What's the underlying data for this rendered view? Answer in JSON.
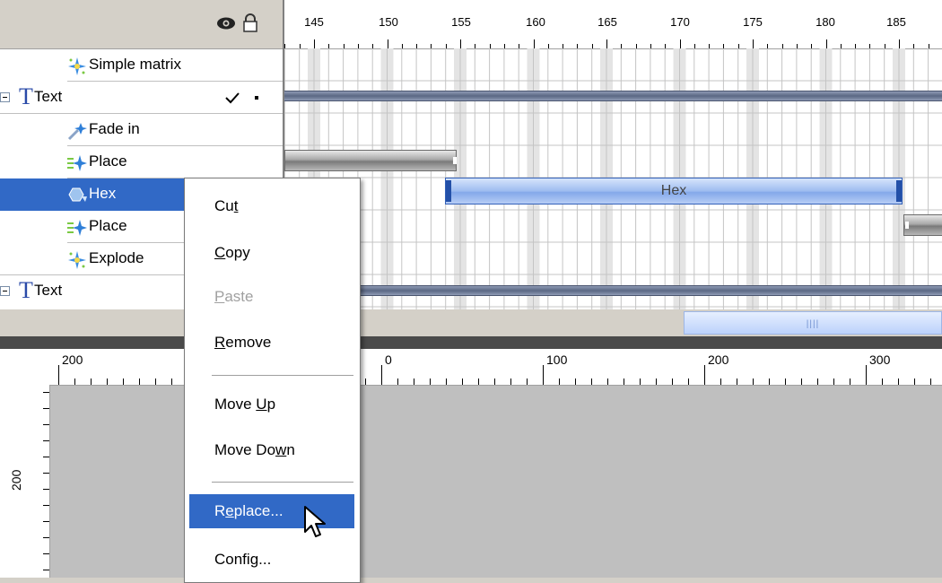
{
  "tree": {
    "rows": [
      {
        "label": "Simple matrix",
        "icon": "sparkle-effect-icon"
      },
      {
        "label": "Text",
        "icon": "text-T-icon"
      },
      {
        "label": "Fade in",
        "icon": "fade-wand-icon"
      },
      {
        "label": "Place",
        "icon": "place-arrow-icon"
      },
      {
        "label": "Hex",
        "icon": "hex-effect-icon"
      },
      {
        "label": "Place",
        "icon": "place-arrow-icon"
      },
      {
        "label": "Explode",
        "icon": "sparkle-effect-icon"
      },
      {
        "label": "Text",
        "icon": "text-T-icon"
      }
    ]
  },
  "timeline": {
    "ruler_labels": [
      "145",
      "150",
      "155",
      "160",
      "165",
      "170",
      "175",
      "180",
      "185"
    ],
    "hex_clip_label": "Hex"
  },
  "canvas": {
    "hruler_labels": [
      "200",
      "0",
      "100",
      "200",
      "300"
    ],
    "vruler_label": "200"
  },
  "context_menu": {
    "cut": {
      "pre": "Cu",
      "key": "t",
      "post": ""
    },
    "copy": {
      "pre": "",
      "key": "C",
      "post": "opy"
    },
    "paste": {
      "pre": "",
      "key": "P",
      "post": "aste"
    },
    "remove": {
      "pre": "",
      "key": "R",
      "post": "emove"
    },
    "move_up": {
      "pre": "Move ",
      "key": "U",
      "post": "p"
    },
    "move_down": {
      "pre": "Move Do",
      "key": "w",
      "post": "n"
    },
    "replace": {
      "pre": "R",
      "key": "e",
      "post": "place..."
    },
    "config": {
      "pre": "Confi",
      "key": "g",
      "post": "..."
    }
  },
  "colors": {
    "selection": "#3169c6",
    "stage_gray": "#bfbfbf"
  }
}
